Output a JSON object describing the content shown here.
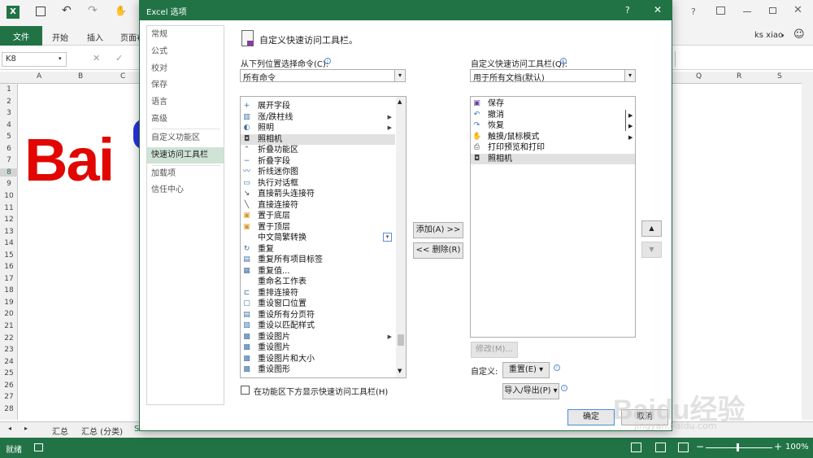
{
  "app": {
    "sheet_title_icons": [
      "excel-icon",
      "save-icon",
      "undo-icon",
      "redo-icon",
      "touch-icon"
    ],
    "tabs": [
      "文件",
      "开始",
      "插入",
      "页面布"
    ],
    "user": "ks xiao",
    "namebox": "K8",
    "columns": [
      "A",
      "B",
      "C",
      "Q",
      "R",
      "S"
    ],
    "rows": [
      "1",
      "2",
      "3",
      "4",
      "5",
      "6",
      "7",
      "8",
      "9",
      "10",
      "11",
      "12",
      "13",
      "14",
      "15",
      "16",
      "17",
      "18",
      "19",
      "20",
      "21",
      "22",
      "23",
      "24",
      "25",
      "26",
      "27",
      "28"
    ],
    "sheet_tabs": [
      "汇总",
      "汇总 (分类)",
      "S"
    ],
    "status": "就绪",
    "zoom": "100%",
    "logo_text": "Bai"
  },
  "dialog": {
    "title": "Excel 选项",
    "help": "?",
    "close": "✕",
    "nav": [
      "常规",
      "公式",
      "校对",
      "保存",
      "语言",
      "高级",
      "自定义功能区",
      "快速访问工具栏",
      "加载项",
      "信任中心"
    ],
    "heading": "自定义快速访问工具栏。",
    "choose_label": "从下列位置选择命令(C):",
    "choose_value": "所有命令",
    "customize_label": "自定义快速访问工具栏(Q):",
    "customize_value": "用于所有文档(默认)",
    "left_items": [
      "展开字段",
      "涨/跌柱线",
      "照明",
      "照相机",
      "折叠功能区",
      "折叠字段",
      "折线迷你图",
      "执行对话框",
      "直接箭头连接符",
      "直接连接符",
      "置于底层",
      "置于顶层",
      "中文简繁转换",
      "重复",
      "重复所有项目标签",
      "重复值...",
      "重命名工作表",
      "重排连接符",
      "重设窗口位置",
      "重设所有分页符",
      "重设以匹配样式",
      "重设图片",
      "重设图片",
      "重设图片和大小",
      "重设图形"
    ],
    "right_items": [
      "保存",
      "撤消",
      "恢复",
      "触摸/鼠标模式",
      "打印预览和打印",
      "照相机"
    ],
    "add_button": "添加(A) >>",
    "remove_button": "<< 删除(R)",
    "modify_button": "修改(M)...",
    "customize_text": "自定义:",
    "reset_button": "重置(E) ▾",
    "import_button": "导入/导出(P) ▾",
    "checkbox_label": "在功能区下方显示快速访问工具栏(H)",
    "ok_button": "确定",
    "cancel_button": "取消"
  },
  "watermark": {
    "text": "Baidu经验",
    "url": "jingyan.baidu.com"
  }
}
